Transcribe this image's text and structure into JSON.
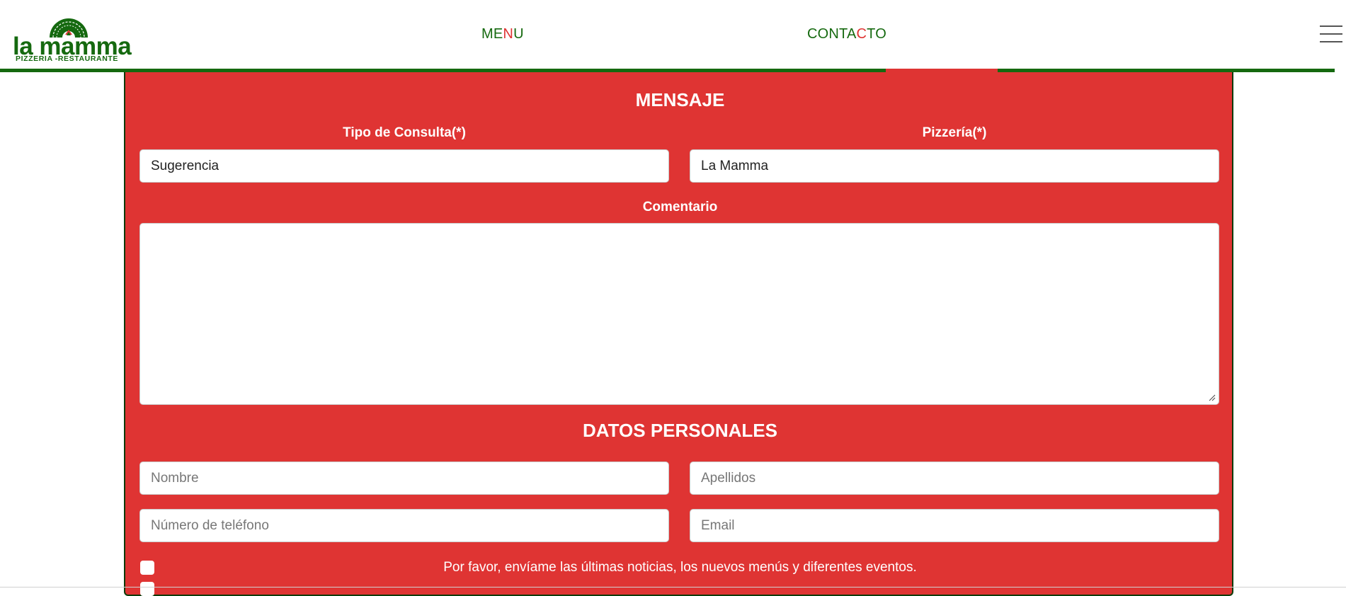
{
  "brand": {
    "name": "la mamma",
    "tagline": "PIZZERIA -RESTAURANTE"
  },
  "nav": {
    "items": [
      {
        "label_start": "ME",
        "label_highlight": "N",
        "label_end": "U"
      },
      {
        "label_start": "CONTA",
        "label_highlight": "C",
        "label_end": "TO"
      }
    ],
    "menu_icon": "hamburger-icon"
  },
  "colors": {
    "brand_green": "#15690f",
    "accent_red": "#df3433",
    "white": "#ffffff"
  },
  "form": {
    "message_section": {
      "title": "MENSAJE",
      "consulta_label": "Tipo de Consulta(*)",
      "consulta_value": "Sugerencia",
      "pizzeria_label": "Pizzería(*)",
      "pizzeria_value": "La Mamma",
      "comentario_label": "Comentario",
      "comentario_value": ""
    },
    "personal_section": {
      "title": "DATOS PERSONALES",
      "nombre_placeholder": "Nombre",
      "apellidos_placeholder": "Apellidos",
      "telefono_placeholder": "Número de teléfono",
      "email_placeholder": "Email"
    },
    "newsletter_text": "Por favor, envíame las últimas noticias, los nuevos menús y diferentes eventos."
  }
}
